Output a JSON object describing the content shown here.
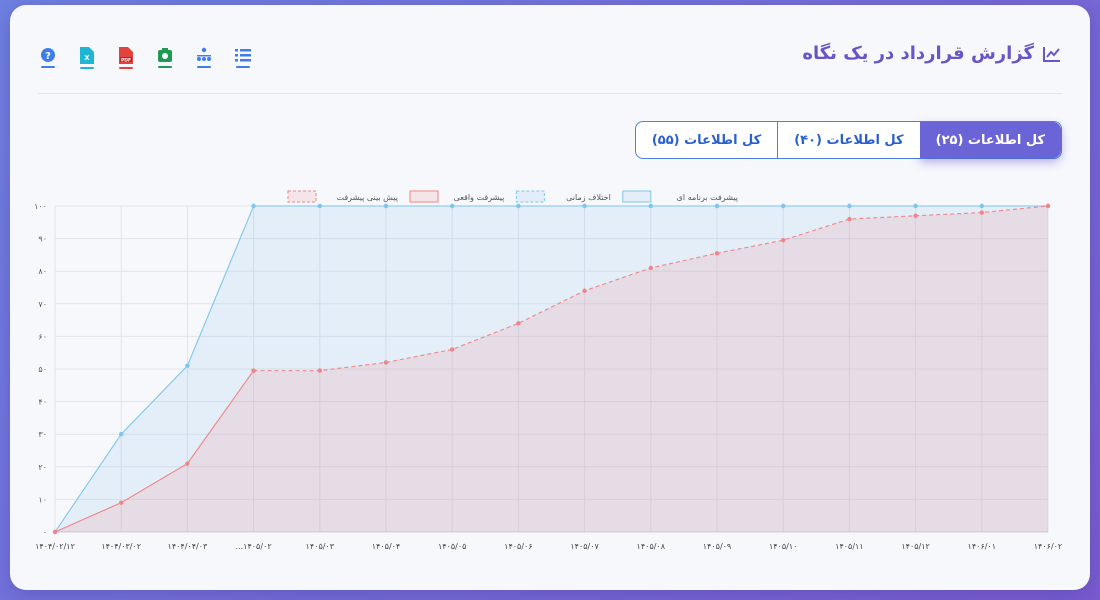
{
  "header": {
    "title": "گزارش قرارداد در یک نگاه",
    "toolbar": [
      {
        "icon": "list-icon",
        "color": "#3f7ee8"
      },
      {
        "icon": "org-chart-icon",
        "color": "#3f7ee8"
      },
      {
        "icon": "camera-icon",
        "color": "#1e9a55"
      },
      {
        "icon": "pdf-icon",
        "color": "#e3423f"
      },
      {
        "icon": "excel-icon",
        "color": "#1fb6d6"
      },
      {
        "icon": "help-icon",
        "color": "#3f7ee8"
      }
    ]
  },
  "tabs": [
    {
      "label": "کل اطلاعات (۲۵)",
      "active": true
    },
    {
      "label": "کل اطلاعات (۴۰)",
      "active": false
    },
    {
      "label": "کل اطلاعات (۵۵)",
      "active": false
    }
  ],
  "chart_data": {
    "type": "area",
    "categories": [
      "۱۴۰۴/۰۲/۱۲",
      "۱۴۰۴/۰۳/۰۲",
      "۱۴۰۴/۰۴/۰۳",
      "...۱۴۰۵/۰۲",
      "۱۴۰۵/۰۳",
      "۱۴۰۵/۰۴",
      "۱۴۰۵/۰۵",
      "۱۴۰۵/۰۶",
      "۱۴۰۵/۰۷",
      "۱۴۰۵/۰۸",
      "۱۴۰۵/۰۹",
      "۱۴۰۵/۱۰",
      "۱۴۰۵/۱۱",
      "۱۴۰۵/۱۲",
      "۱۴۰۶/۰۱",
      "۱۴۰۶/۰۲"
    ],
    "series": [
      {
        "name": "پیشرفت برنامه ای",
        "color": "#7fc6e8",
        "dashed": false,
        "fill": true,
        "values": [
          0,
          30,
          51,
          100,
          100,
          100,
          100,
          100,
          100,
          100,
          100,
          100,
          100,
          100,
          100,
          100
        ]
      },
      {
        "name": "اختلاف زمانی",
        "color": "#7fc6e8",
        "dashed": true,
        "fill": false,
        "values": [
          null,
          null,
          null,
          100,
          100,
          100,
          100,
          100,
          100,
          100,
          100,
          100,
          100,
          100,
          100,
          100
        ]
      },
      {
        "name": "پیشرفت واقعی",
        "color": "#f08585",
        "dashed": false,
        "fill": true,
        "values": [
          0,
          9,
          21,
          49.5,
          null,
          null,
          null,
          null,
          null,
          null,
          null,
          null,
          null,
          null,
          null,
          null
        ]
      },
      {
        "name": "پیش بینی پیشرفت",
        "color": "#f08585",
        "dashed": true,
        "fill": true,
        "values": [
          null,
          null,
          null,
          49.5,
          49.5,
          52,
          56,
          64,
          74,
          81,
          85.5,
          89.5,
          96,
          97,
          98,
          100
        ]
      }
    ],
    "yticks": [
      "۰",
      "۱۰",
      "۲۰",
      "۳۰",
      "۴۰",
      "۵۰",
      "۶۰",
      "۷۰",
      "۸۰",
      "۹۰",
      "۱۰۰"
    ],
    "ylim": [
      0,
      100
    ],
    "grid": true,
    "legend_position": "top-center"
  }
}
